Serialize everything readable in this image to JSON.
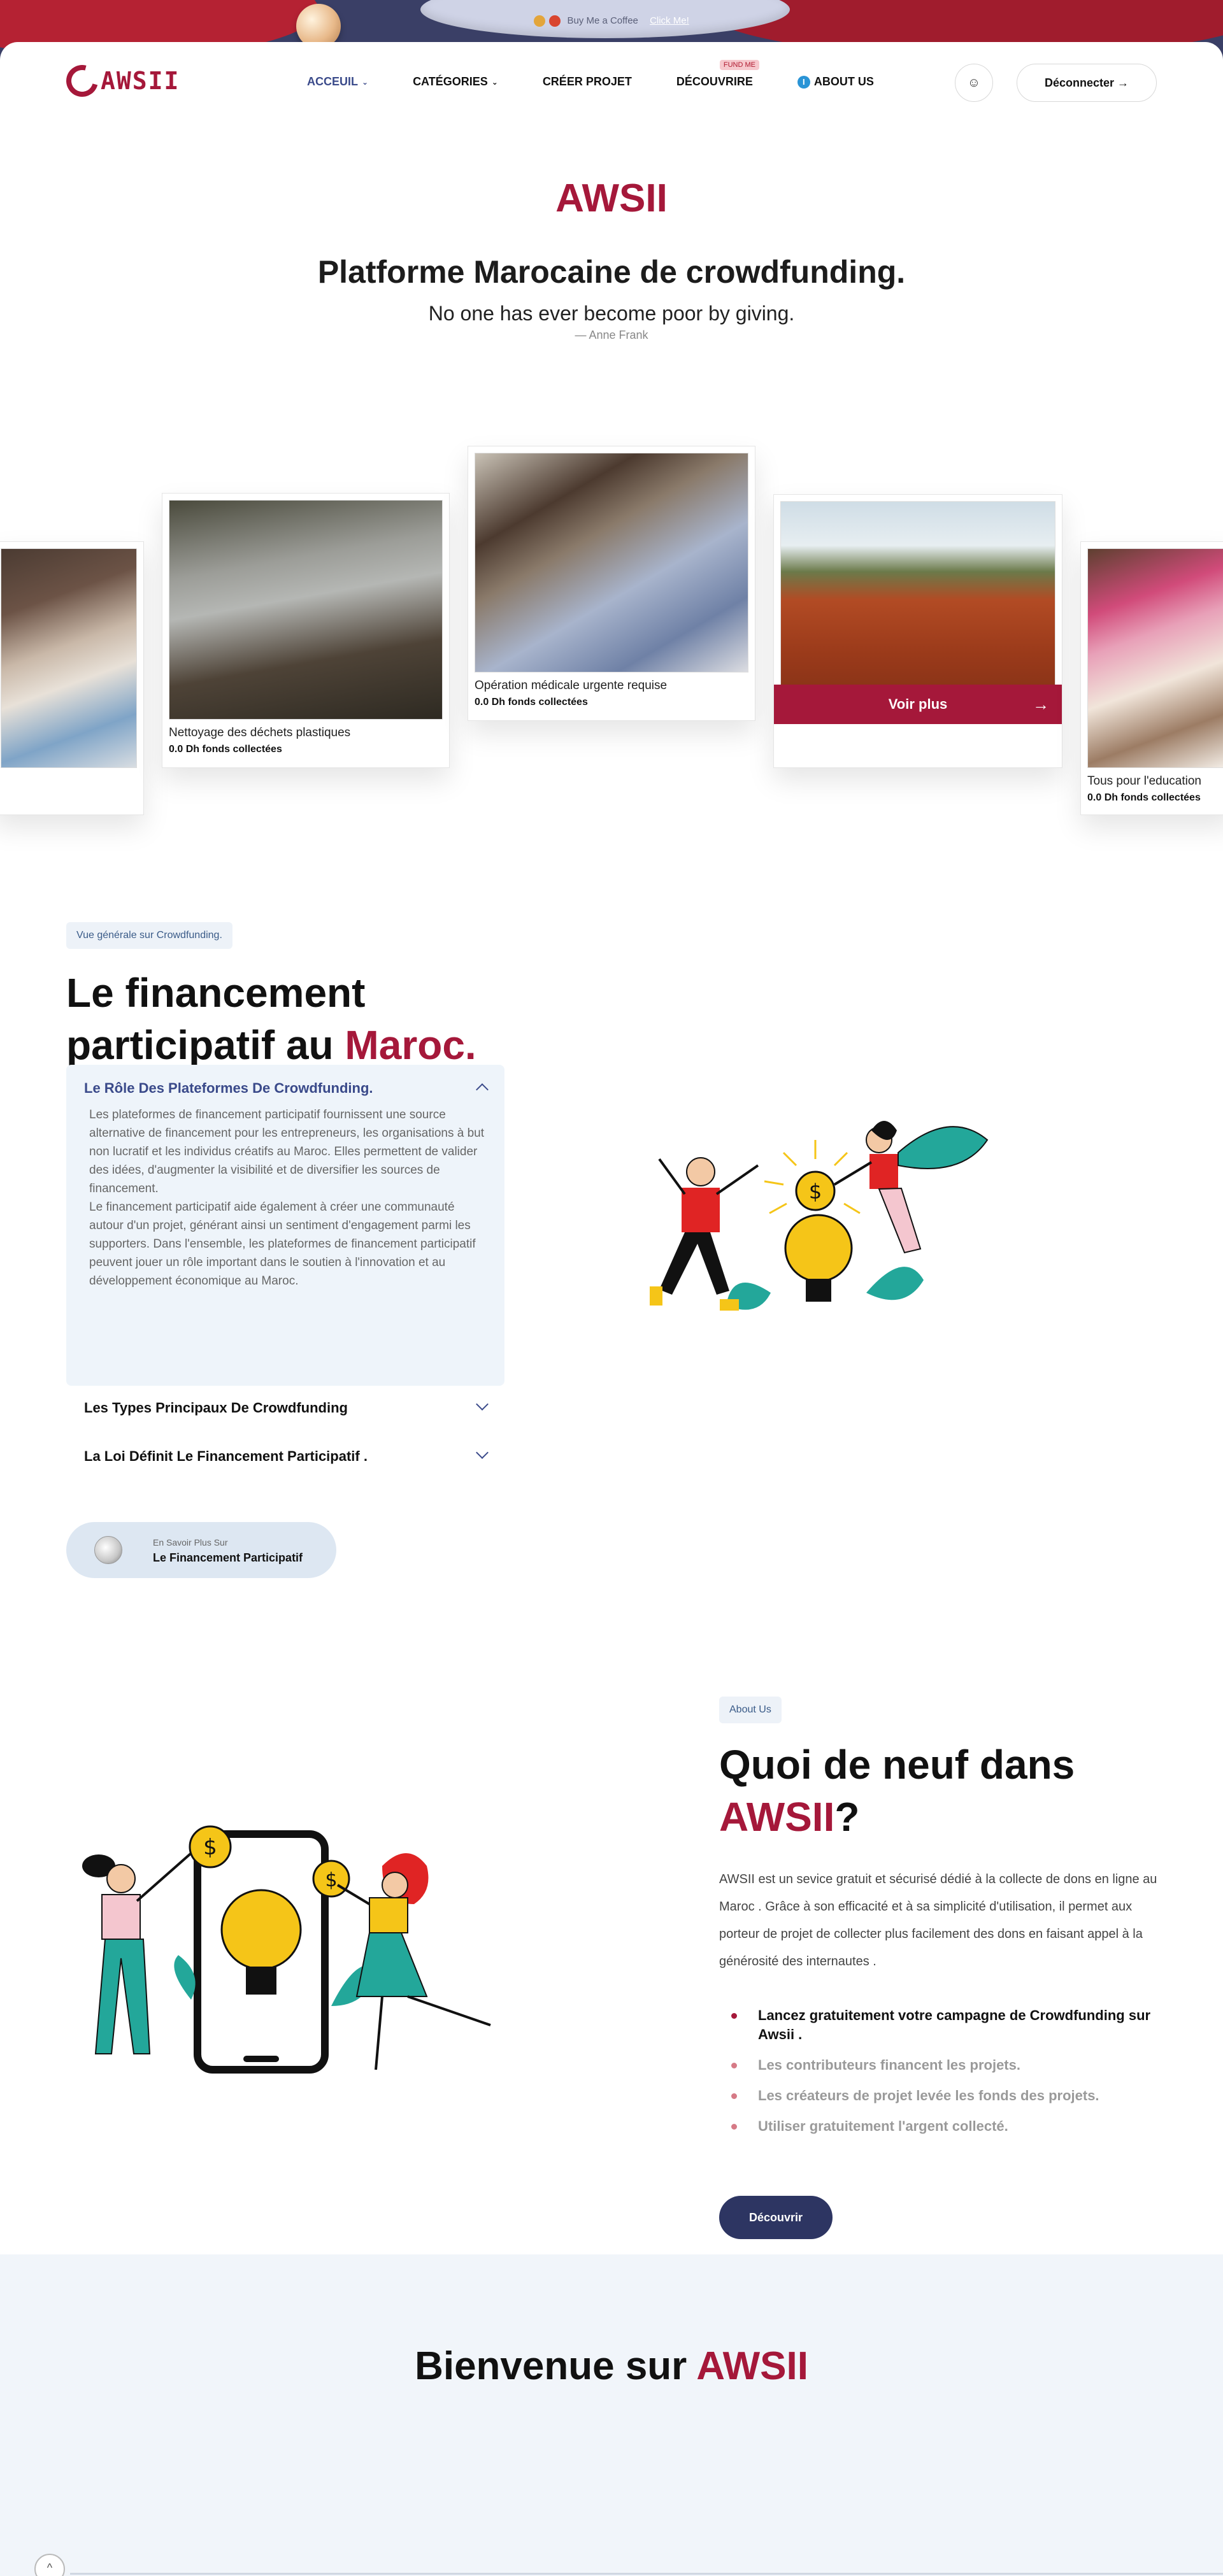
{
  "banner": {
    "text": "Buy Me a Coffee",
    "link": "Click Me!"
  },
  "header": {
    "logo_text": "AWSII",
    "nav": [
      {
        "label": "ACCEUIL",
        "has_dropdown": true,
        "active": true
      },
      {
        "label": "CATÉGORIES",
        "has_dropdown": true
      },
      {
        "label": "CRÉER PROJET"
      },
      {
        "label": "DÉCOUVRIRE",
        "badge": "FUND ME"
      },
      {
        "label": "ABOUT US",
        "icon": "info-icon"
      }
    ],
    "user_icon": "user-icon",
    "logout_label": "Déconnecter"
  },
  "hero": {
    "brand": "AWSII",
    "title": "Platforme Marocaine de crowdfunding.",
    "quote": "No one has ever become poor by giving.",
    "author": "— Anne Frank"
  },
  "projects": [
    {
      "title": "",
      "amount": "",
      "image": "children-in-classroom"
    },
    {
      "title": "Nettoyage des déchets plastiques",
      "amount": "0.0 Dh fonds collectées",
      "image": "plastic-waste-cleanup"
    },
    {
      "title": "Opération médicale urgente requise",
      "amount": "0.0 Dh fonds collectées",
      "image": "patient-in-hospital"
    },
    {
      "title": "",
      "amount": "",
      "image": "farmer-ploughing-field"
    },
    {
      "title": "Tous pour l'education",
      "amount": "0.0 Dh fonds collectées",
      "image": "girl-studying"
    }
  ],
  "voir_plus": "Voir plus",
  "crowdfunding": {
    "chip": "Vue générale sur Crowdfunding.",
    "title_part1": "Le financement",
    "title_part2": "participatif au ",
    "title_accent": "Maroc.",
    "accordion": [
      {
        "title": "Le Rôle Des Plateformes De Crowdfunding.",
        "open": true,
        "body_1": "Les plateformes de financement participatif fournissent une source alternative de financement pour les entrepreneurs, les organisations à but non lucratif et les individus créatifs au Maroc. Elles permettent de valider des idées, d'augmenter la visibilité et de diversifier les sources de financement.",
        "body_2": "Le financement participatif aide également à créer une communauté autour d'un projet, générant ainsi un sentiment d'engagement parmi les supporters. Dans l'ensemble, les plateformes de financement participatif peuvent jouer un rôle important dans le soutien à l'innovation et au développement économique au Maroc."
      },
      {
        "title": "Les Types Principaux De Crowdfunding",
        "open": false
      },
      {
        "title": "La Loi Définit Le Financement Participatif .",
        "open": false
      }
    ],
    "learn_more_small": "En Savoir Plus Sur",
    "learn_more_big": "Le Financement Participatif"
  },
  "about": {
    "chip": "About Us",
    "title_part1": "Quoi de neuf dans",
    "title_accent": "AWSII",
    "title_end": "?",
    "text": "AWSII est un sevice gratuit et sécurisé dédié à la collecte de dons en ligne au Maroc . Grâce à son efficacité et à sa simplicité d'utilisation, il permet aux porteur de projet de collecter plus facilement des dons en faisant appel à la générosité des internautes .",
    "bullets": [
      "Lancez gratuitement votre campagne de Crowdfunding sur Awsii .",
      "Les contributeurs financent les projets.",
      "Les créateurs de projet levée les fonds des projets.",
      "Utiliser gratuitement l'argent collecté."
    ],
    "button": "Découvrir"
  },
  "welcome": {
    "title_part1": "Bienvenue sur ",
    "title_accent": "AWSII"
  },
  "colors": {
    "brand": "#a5183a",
    "navy": "#2d3562",
    "nav_active": "#3a4a8a"
  }
}
